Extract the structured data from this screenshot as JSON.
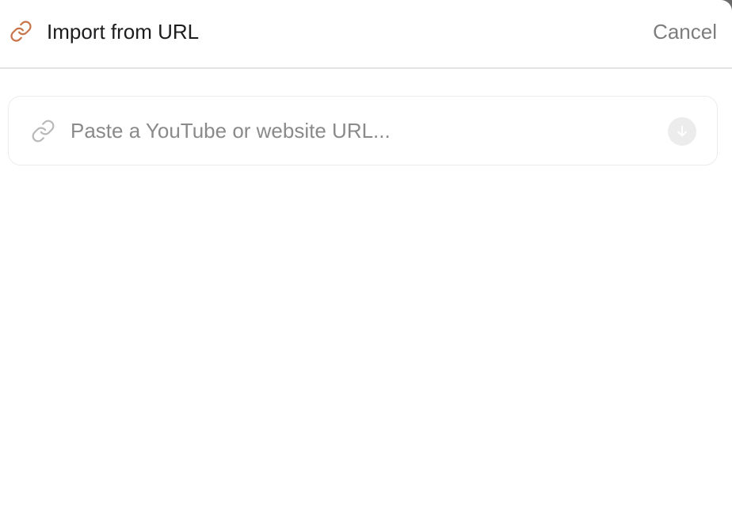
{
  "header": {
    "title": "Import from URL",
    "cancel_label": "Cancel",
    "icon": "link-icon",
    "icon_color": "#c8744a"
  },
  "url_field": {
    "value": "",
    "placeholder": "Paste a YouTube or website URL...",
    "icon": "link-icon",
    "submit_icon": "arrow-down-icon"
  },
  "colors": {
    "accent": "#c8744a",
    "muted_text": "#7d7d7d",
    "border": "#ececec"
  }
}
